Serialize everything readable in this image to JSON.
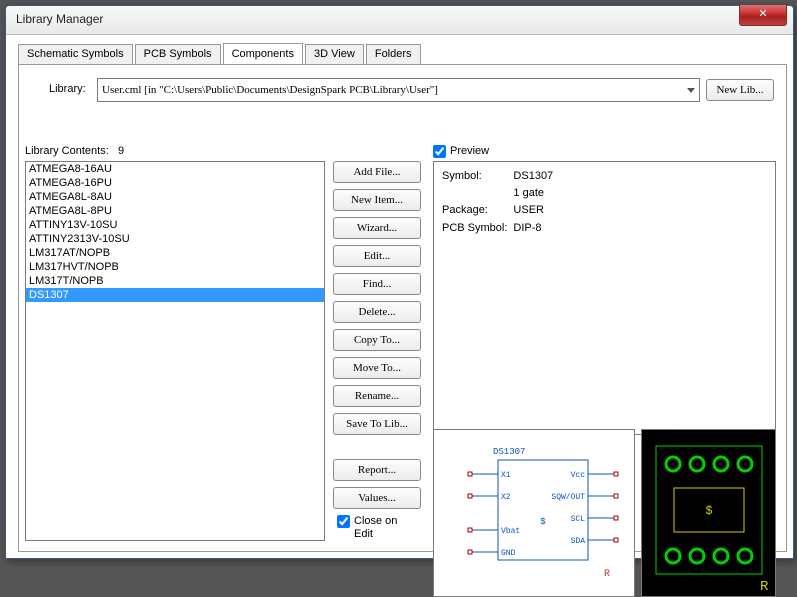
{
  "window": {
    "title": "Library Manager"
  },
  "tabs": [
    "Schematic Symbols",
    "PCB Symbols",
    "Components",
    "3D View",
    "Folders"
  ],
  "active_tab": 2,
  "library": {
    "label": "Library:",
    "value": "User.cml   [in \"C:\\Users\\Public\\Documents\\DesignSpark PCB\\Library\\User\"]",
    "new_btn": "New Lib..."
  },
  "contents": {
    "label": "Library Contents:",
    "count": "9",
    "items": [
      "ATMEGA8-16AU",
      "ATMEGA8-16PU",
      "ATMEGA8L-8AU",
      "ATMEGA8L-8PU",
      "ATTINY13V-10SU",
      "ATTINY2313V-10SU",
      "LM317AT/NOPB",
      "LM317HVT/NOPB",
      "LM317T/NOPB",
      "DS1307"
    ],
    "selected": 9
  },
  "buttons": {
    "addfile": "Add File...",
    "newitem": "New Item...",
    "wizard": "Wizard...",
    "edit": "Edit...",
    "find": "Find...",
    "delete": "Delete...",
    "copyto": "Copy To...",
    "moveto": "Move To...",
    "rename": "Rename...",
    "saveto": "Save To Lib...",
    "report": "Report...",
    "values": "Values...",
    "close_on_edit": "Close on Edit"
  },
  "preview": {
    "label": "Preview",
    "info": {
      "symbol_l": "Symbol:",
      "symbol_v": "DS1307",
      "gates": "1 gate",
      "package_l": "Package:",
      "package_v": "USER",
      "pcbsym_l": "PCB Symbol:",
      "pcbsym_v": "DIP-8"
    }
  },
  "schematic": {
    "ref": "DS1307",
    "pins_left": [
      "X1",
      "X2",
      "Vbat",
      "GND"
    ],
    "pins_right": [
      "Vcc",
      "SQW/OUT",
      "SCL",
      "SDA"
    ],
    "suffix": "R"
  },
  "pcb": {
    "ref": "R"
  }
}
